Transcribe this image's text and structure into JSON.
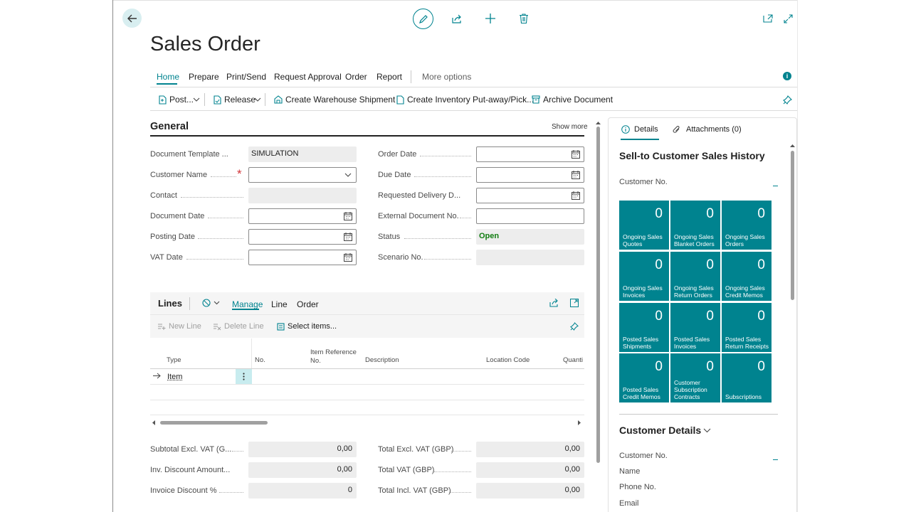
{
  "page": {
    "title": "Sales Order"
  },
  "tabs": [
    "Home",
    "Prepare",
    "Print/Send",
    "Request Approval",
    "Order",
    "Report",
    "More options"
  ],
  "actions": {
    "post": "Post...",
    "release": "Release",
    "warehouse": "Create Warehouse Shipment",
    "inventory": "Create Inventory Put-away/Pick...",
    "archive": "Archive Document"
  },
  "general": {
    "title": "General",
    "show_more": "Show more",
    "left_fields": [
      {
        "label": "Document Template ...",
        "value": "SIMULATION"
      },
      {
        "label": "Customer Name",
        "value": ""
      },
      {
        "label": "Contact",
        "value": ""
      },
      {
        "label": "Document Date",
        "value": ""
      },
      {
        "label": "Posting Date",
        "value": ""
      },
      {
        "label": "VAT Date",
        "value": ""
      }
    ],
    "right_fields": [
      {
        "label": "Order Date",
        "value": ""
      },
      {
        "label": "Due Date",
        "value": ""
      },
      {
        "label": "Requested Delivery D...",
        "value": ""
      },
      {
        "label": "External Document No.",
        "value": ""
      },
      {
        "label": "Status",
        "value": "Open"
      },
      {
        "label": "Scenario No.",
        "value": ""
      }
    ]
  },
  "lines": {
    "title": "Lines",
    "tabs": [
      "Manage",
      "Line",
      "Order"
    ],
    "new_line": "New Line",
    "delete_line": "Delete Line",
    "select_items": "Select items...",
    "columns": [
      "Type",
      "No.",
      "Item Reference No.",
      "Description",
      "Location Code",
      "Quanti"
    ],
    "row_type": "Item"
  },
  "totals": {
    "left": [
      {
        "label": "Subtotal Excl. VAT (G...",
        "value": "0,00"
      },
      {
        "label": "Inv. Discount Amount...",
        "value": "0,00"
      },
      {
        "label": "Invoice Discount %",
        "value": "0"
      }
    ],
    "right": [
      {
        "label": "Total Excl. VAT (GBP)",
        "value": "0,00"
      },
      {
        "label": "Total VAT (GBP)",
        "value": "0,00"
      },
      {
        "label": "Total Incl. VAT (GBP)",
        "value": "0,00"
      }
    ]
  },
  "factbox": {
    "tab_details": "Details",
    "tab_attachments": "Attachments (0)",
    "history_title": "Sell-to Customer Sales History",
    "customer_no": "Customer No.",
    "tiles": [
      {
        "value": "0",
        "label": "Ongoing Sales Quotes"
      },
      {
        "value": "0",
        "label": "Ongoing Sales Blanket Orders"
      },
      {
        "value": "0",
        "label": "Ongoing Sales Orders"
      },
      {
        "value": "0",
        "label": "Ongoing Sales Invoices"
      },
      {
        "value": "0",
        "label": "Ongoing Sales Return Orders"
      },
      {
        "value": "0",
        "label": "Ongoing Sales Credit Memos"
      },
      {
        "value": "0",
        "label": "Posted Sales Shipments"
      },
      {
        "value": "0",
        "label": "Posted Sales Invoices"
      },
      {
        "value": "0",
        "label": "Posted Sales Return Receipts"
      },
      {
        "value": "0",
        "label": "Posted Sales Credit Memos"
      },
      {
        "value": "0",
        "label": "Customer Subscription Contracts"
      },
      {
        "value": "0",
        "label": "Subscriptions"
      }
    ],
    "customer_details_title": "Customer Details",
    "details_fields": [
      "Customer No.",
      "Name",
      "Phone No.",
      "Email"
    ]
  },
  "colors": {
    "accent": "#00838f",
    "status_open": "#107c10",
    "required": "#d13438"
  }
}
